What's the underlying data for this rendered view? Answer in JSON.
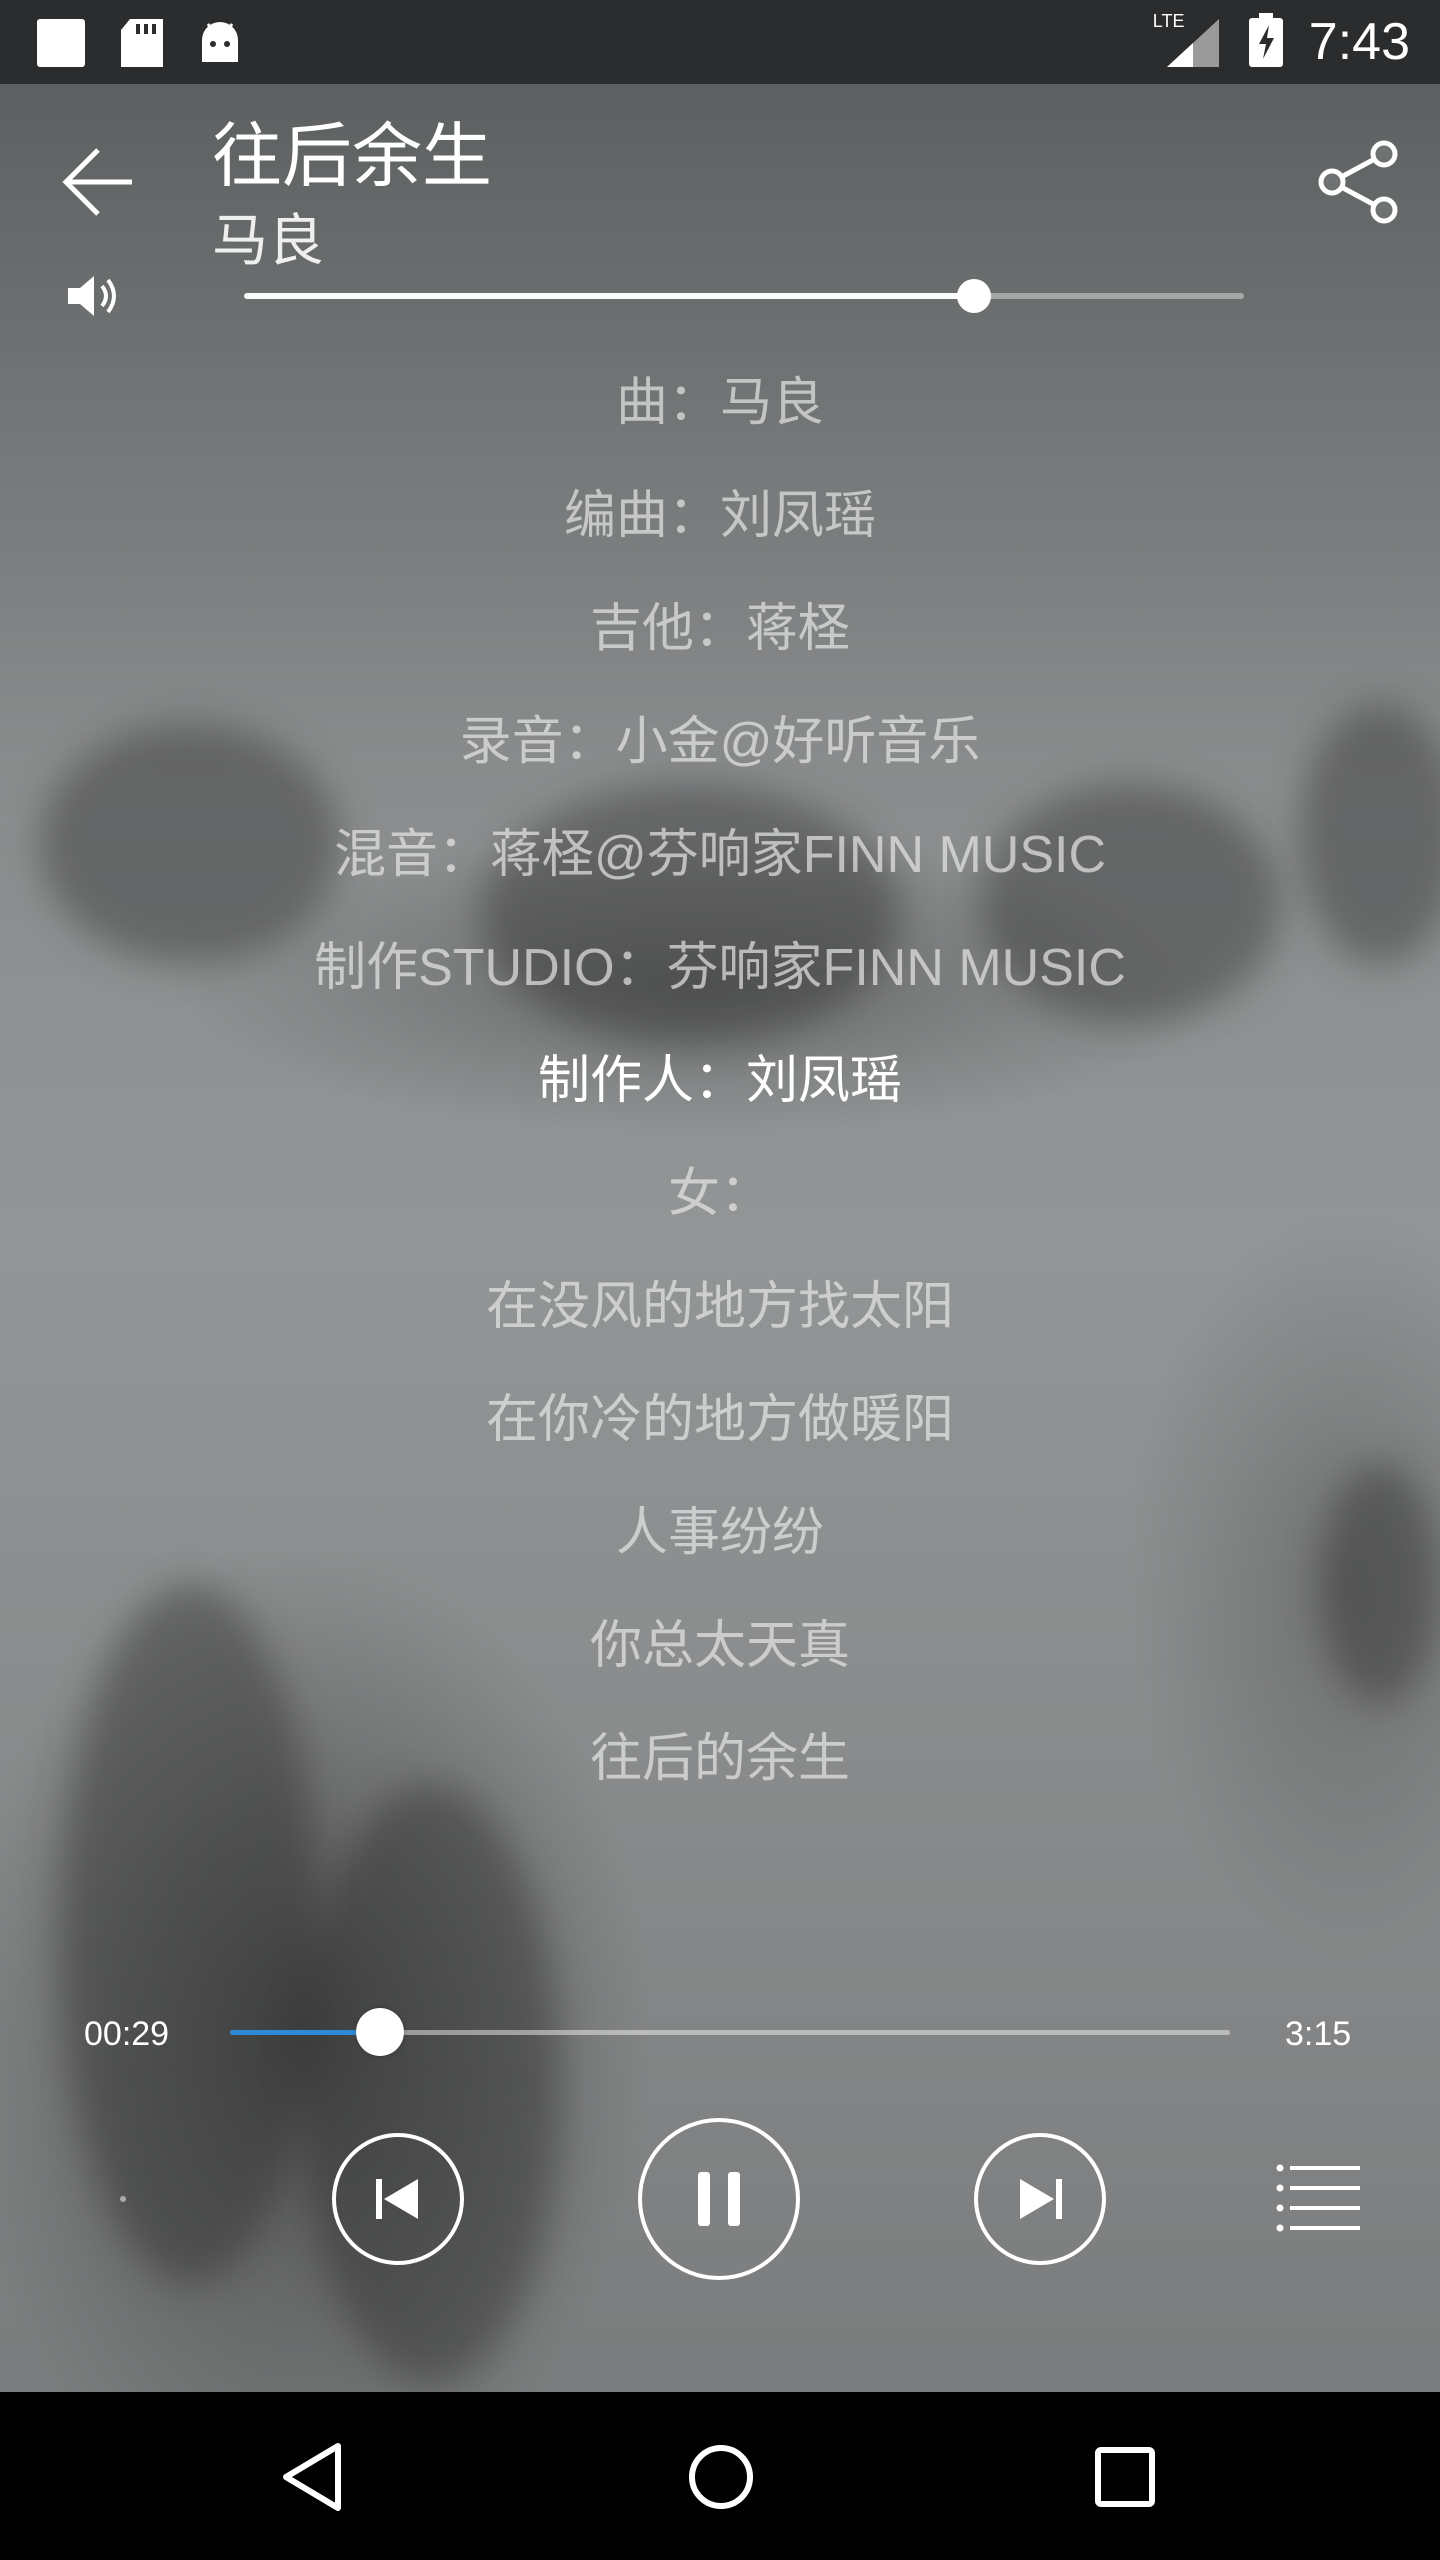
{
  "status_bar": {
    "time": "7:43",
    "network": "LTE",
    "icons": [
      "notification-square-icon",
      "sd-card-icon",
      "android-icon",
      "signal-icon",
      "battery-charging-icon"
    ]
  },
  "player": {
    "title": "往后余生",
    "artist": "马良",
    "volume_level": 0.73,
    "lyrics": [
      "曲：马良",
      "编曲：刘凤瑶",
      "吉他：蒋柽",
      "录音：小金@好听音乐",
      "混音：蒋柽@芬响家FINN MUSIC",
      "制作STUDIO：芬响家FINN MUSIC",
      "制作人：刘凤瑶",
      "女：",
      "在没风的地方找太阳",
      "在你冷的地方做暖阳",
      "人事纷纷",
      "你总太天真",
      "往后的余生"
    ],
    "active_lyric_index": 6,
    "current_time": "00:29",
    "total_time": "3:15",
    "progress": 0.15
  },
  "colors": {
    "accent": "#2e8ad8",
    "status_bar_bg": "#2b2c2d",
    "nav_bar_bg": "#000000"
  }
}
